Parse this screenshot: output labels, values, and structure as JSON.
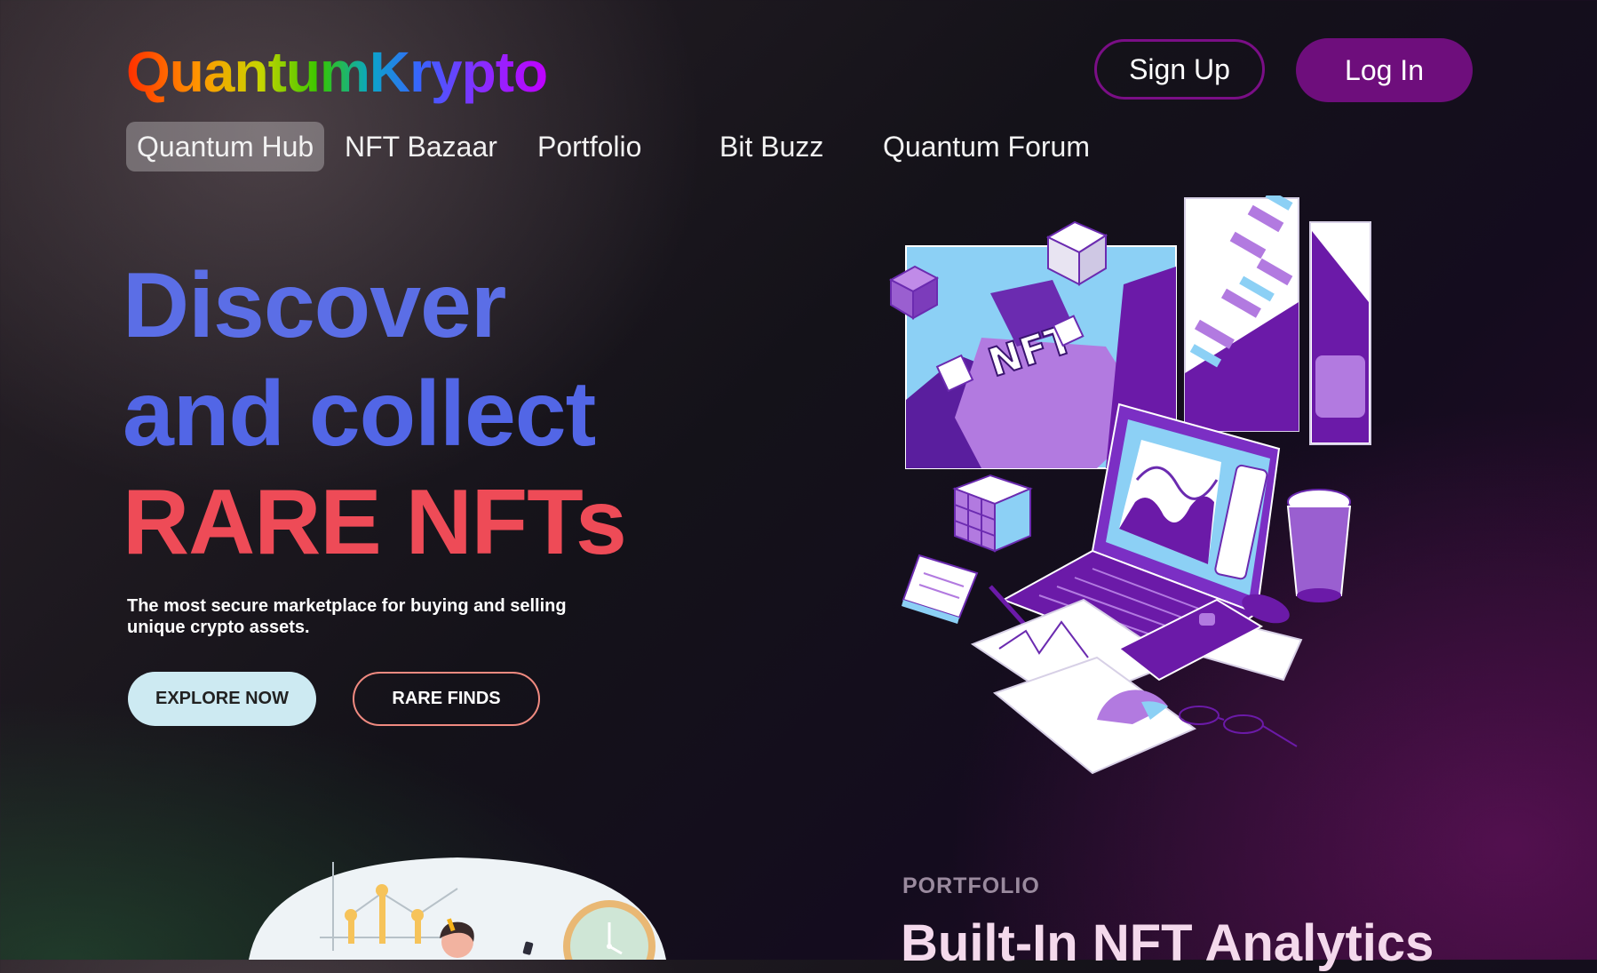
{
  "header": {
    "logo": "QuantumKrypto",
    "signup_label": "Sign Up",
    "login_label": "Log In"
  },
  "nav": {
    "items": [
      {
        "label": "Quantum Hub",
        "active": true
      },
      {
        "label": "NFT Bazaar",
        "active": false
      },
      {
        "label": "Portfolio",
        "active": false
      },
      {
        "label": "Bit Buzz",
        "active": false
      },
      {
        "label": "Quantum Forum",
        "active": false
      }
    ]
  },
  "hero": {
    "line1": "Discover",
    "line2": "and collect",
    "line3": "RARE NFTs",
    "subtitle": "The most secure marketplace for buying and selling unique crypto assets.",
    "explore_label": "EXPLORE NOW",
    "rare_label": "RARE FINDS",
    "art_text": "NFT"
  },
  "section": {
    "label": "PORTFOLIO",
    "title": "Built-In NFT Analytics"
  },
  "colors": {
    "accent_purple": "#6e0e7c",
    "hero_blue": "#5b6ee6",
    "hero_red": "#ee4b57",
    "explore_bg": "#cdeaf2"
  }
}
